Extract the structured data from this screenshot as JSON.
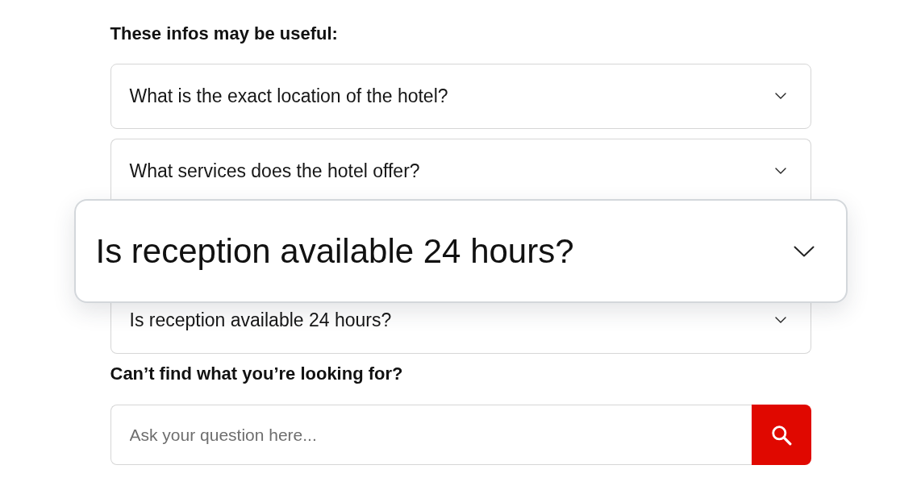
{
  "heading": "These infos may be useful:",
  "faqs": [
    {
      "question": "What is the exact location of the hotel?",
      "kind": "plain",
      "expanded": false
    },
    {
      "question": "What services does the hotel offer?",
      "kind": "plain",
      "expanded": false
    },
    {
      "question": "Is reception available 24 hours?",
      "kind": "magnified",
      "expanded": false
    },
    {
      "question": "Is reception available 24 hours?",
      "kind": "plain",
      "expanded": false
    }
  ],
  "help": {
    "heading": "Can’t find what you’re looking for?",
    "search": {
      "placeholder": "Ask your question here..."
    }
  }
}
